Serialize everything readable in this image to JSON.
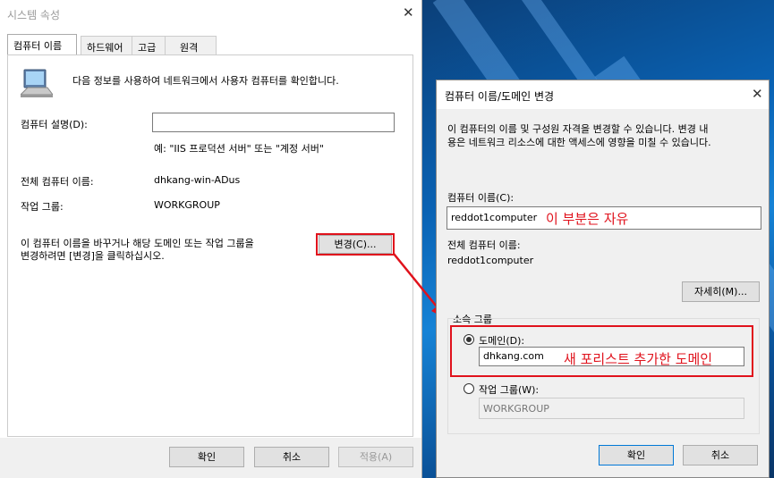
{
  "left_dialog": {
    "title": "시스템 속성",
    "close_glyph": "✕",
    "tabs": [
      "컴퓨터 이름",
      "하드웨어",
      "고급",
      "원격"
    ],
    "intro_text": "다음 정보를 사용하여 네트워크에서 사용자 컴퓨터를 확인합니다.",
    "description_label": "컴퓨터 설명(D):",
    "description_value": "",
    "example_text": "예: \"IIS 프로덕션 서버\" 또는 \"계정 서버\"",
    "full_name_label": "전체 컴퓨터 이름:",
    "full_name_value": "dhkang-win-ADus",
    "workgroup_label": "작업 그룹:",
    "workgroup_value": "WORKGROUP",
    "change_text_line1": "이 컴퓨터 이름을 바꾸거나 해당 도메인 또는 작업 그룹을",
    "change_text_line2": "변경하려면 [변경]을 클릭하십시오.",
    "change_button": "변경(C)...",
    "ok_button": "확인",
    "cancel_button": "취소",
    "apply_button": "적용(A)"
  },
  "right_dialog": {
    "title": "컴퓨터 이름/도메인 변경",
    "close_glyph": "✕",
    "intro_line1": "이 컴퓨터의 이름 및 구성원 자격을 변경할 수 있습니다. 변경 내",
    "intro_line2": "용은 네트워크 리소스에 대한 액세스에 영향을 미칠 수 있습니다.",
    "computer_name_label": "컴퓨터 이름(C):",
    "computer_name_value": "reddot1computer",
    "annotation_free": "이 부분은 자유",
    "full_name_label": "전체 컴퓨터 이름:",
    "full_name_value": "reddot1computer",
    "more_button": "자세히(M)...",
    "member_group_label": "소속 그룹",
    "domain_label": "도메인(D):",
    "domain_value": "dhkang.com",
    "annotation_domain": "새 포리스트 추가한 도메인",
    "workgroup_label": "작업 그룹(W):",
    "workgroup_value": "WORKGROUP",
    "ok_button": "확인",
    "cancel_button": "취소"
  },
  "colors": {
    "annotation_red": "#e0121c",
    "desktop_blue": "#0a62b3"
  }
}
